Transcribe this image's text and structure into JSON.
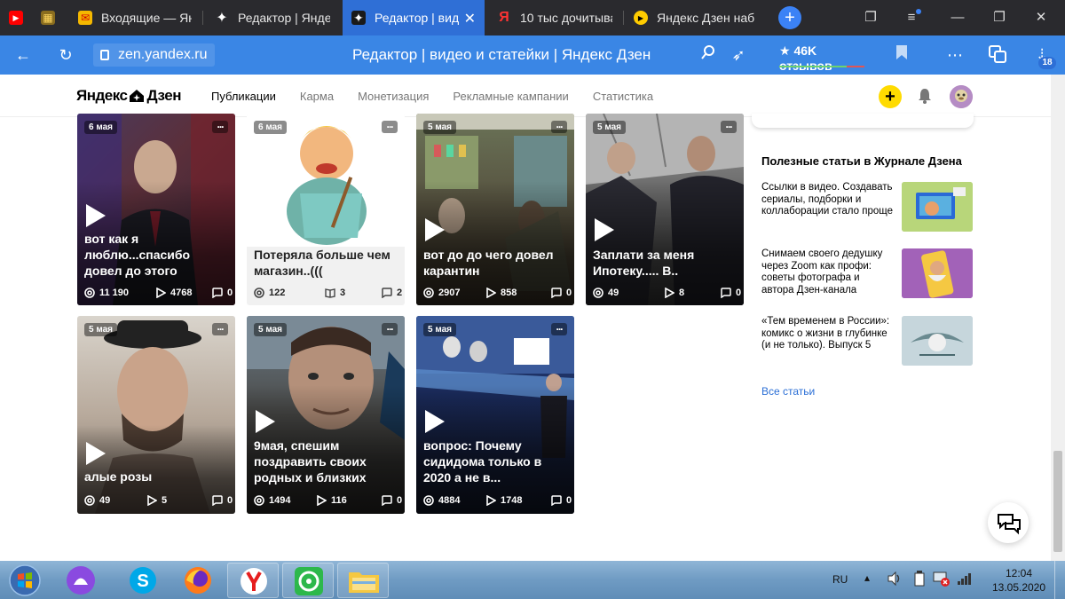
{
  "browser": {
    "tabs": [
      {
        "title": "",
        "icon": "youtube-icon",
        "color": "#ff0000"
      },
      {
        "title": "",
        "icon": "cart-icon",
        "color": "#c8a84a"
      },
      {
        "title": "Входящие — Янд",
        "icon": "mail-icon",
        "color": "#f5b800"
      },
      {
        "title": "Редактор | Яндекс",
        "icon": "zen-icon",
        "color": "#ffffff"
      },
      {
        "title": "Редактор | вид",
        "icon": "zen-icon",
        "color": "#ffffff"
      },
      {
        "title": "10 тыс дочитыва",
        "icon": "yandex-icon",
        "color": "#ff3333"
      },
      {
        "title": "Яндекс Дзен наб",
        "icon": "play-icon",
        "color": "#ffcc00"
      }
    ],
    "url": "zen.yandex.ru",
    "page_title": "Редактор | видео и статейки | Яндекс Дзен",
    "reviews": "★ 46K отзывов",
    "downloads_badge": "18"
  },
  "header": {
    "logo": {
      "left": "Яндекс",
      "right": "Дзен"
    },
    "nav": [
      "Публикации",
      "Карма",
      "Монетизация",
      "Рекламные кампании",
      "Статистика"
    ],
    "add_label": "+"
  },
  "cards": [
    {
      "date": "6 мая",
      "title": "вот как я люблю...спасибо довел до этого",
      "views": "11 190",
      "plays": "4768",
      "comments": "0",
      "kind": "video"
    },
    {
      "date": "6 мая",
      "title": "Потеряла больше чем магазин..(((",
      "views": "122",
      "plays": "3",
      "comments": "2",
      "kind": "article"
    },
    {
      "date": "5 мая",
      "title": "вот до до чего довел карантин",
      "views": "2907",
      "plays": "858",
      "comments": "0",
      "kind": "video"
    },
    {
      "date": "5 мая",
      "title": "Заплати за меня Ипотеку..... В..",
      "views": "49",
      "plays": "8",
      "comments": "0",
      "kind": "video"
    },
    {
      "date": "5 мая",
      "title": "алые розы",
      "views": "49",
      "plays": "5",
      "comments": "0",
      "kind": "video"
    },
    {
      "date": "5 мая",
      "title": "9мая, спешим поздравить своих родных и близких",
      "views": "1494",
      "plays": "116",
      "comments": "0",
      "kind": "video"
    },
    {
      "date": "5 мая",
      "title": "вопрос: Почему сидидома только в 2020 а не в...",
      "views": "4884",
      "plays": "1748",
      "comments": "0",
      "kind": "video"
    }
  ],
  "sidebar": {
    "title": "Полезные статьи в Журнале Дзена",
    "articles": [
      {
        "text": "Ссылки в видео. Создавать сериалы, подборки и коллаборации стало проще"
      },
      {
        "text": "Снимаем своего дедушку через Zoom как профи: советы фотографа и автора Дзен-канала"
      },
      {
        "text": "«Тем временем в России»: комикс о жизни в глубинке (и не только). Выпуск 5"
      }
    ],
    "all_link": "Все статьи"
  },
  "taskbar": {
    "lang": "RU",
    "time": "12:04",
    "date": "13.05.2020"
  }
}
